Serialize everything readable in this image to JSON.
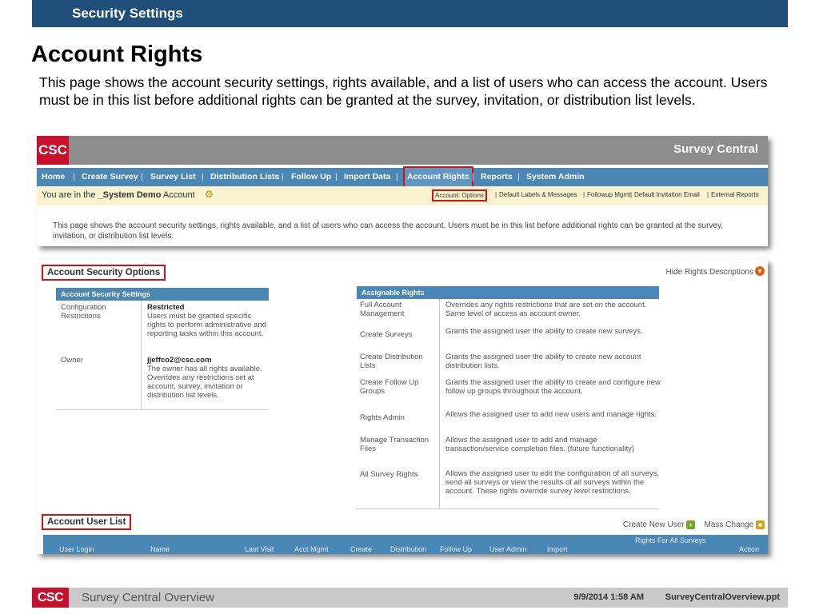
{
  "slide": {
    "header": "Security Settings",
    "title": "Account Rights",
    "description": "This page shows the account security settings, rights available, and a list of users who can access the account. Users must be in this list before additional rights can be granted at the survey, invitation, or distribution list levels."
  },
  "app": {
    "logo": "CSC",
    "title": "Survey Central",
    "nav": [
      "Home",
      "Create Survey",
      "Survey List",
      "Distribution Lists",
      "Follow Up",
      "Import Data",
      "Account Rights",
      "Reports",
      "System Admin"
    ],
    "nav_separator": "|",
    "breadcrumb": {
      "prefix": "You are in the ",
      "account": "_System Demo",
      "suffix": " Account"
    },
    "subnav": [
      "Account: Options",
      "Default Labels & Messages",
      "Followup Mgmt",
      "Default Invitation Email",
      "External Reports"
    ],
    "subnav_separator": "|",
    "page_description": "This page shows the account security settings, rights available, and a list of users who can access the account. Users must be in this list before additional rights can be granted at the survey, invitation, or distribution list levels."
  },
  "options": {
    "section_title": "Account Security Options",
    "hide_rights": "Hide Rights Descriptions",
    "settings_header": "Account Security Settings",
    "settings": [
      {
        "label": "Configuration Restrictions",
        "value": "Restricted",
        "detail": "Users must be granted specific rights to perform administrative and reporting tasks within this account."
      },
      {
        "label": "Owner",
        "value": "jjeffco2@csc.com",
        "detail": "The owner has all rights available. Overrides any restrictions set at account, survey, invitation or distribution list levels."
      }
    ],
    "rights_header": "Assignable Rights",
    "rights": [
      {
        "name": "Full Account Management",
        "desc": "Overrides any rights restrictions that are set on the account. Same level of access as account owner."
      },
      {
        "name": "Create Surveys",
        "desc": "Grants the assigned user the ability to create new surveys."
      },
      {
        "name": "Create Distribution Lists",
        "desc": "Grants the assigned user the ability to create new account distribution lists."
      },
      {
        "name": "Create Follow Up Groups",
        "desc": "Grants the assigned user the ability to create and configure new follow up groups throughout the account."
      },
      {
        "name": "Rights Admin",
        "desc": "Allows the assigned user to add new users and manage rights."
      },
      {
        "name": "Manage Transaction Files",
        "desc": "Allows the assigned user to add and manage transaction/service completion files. (future functionality)"
      },
      {
        "name": "All Survey Rights",
        "desc": "Allows the assigned user to edit the configuration of all surveys, send all surveys or view the results of all surveys within the account. These rights override survey level restrictions."
      }
    ]
  },
  "user_list": {
    "section_title": "Account User List",
    "create_new_user": "Create New User",
    "mass_change": "Mass Change",
    "rights_group_label": "Rights For All Surveys",
    "columns": [
      "User Login",
      "Name",
      "Last Visit",
      "Acct Mgmt",
      "Create",
      "Distribution",
      "Follow Up",
      "User Admin",
      "Import",
      "Action"
    ]
  },
  "footer": {
    "logo": "CSC",
    "title": "Survey Central Overview",
    "date": "9/9/2014 1:58 AM",
    "file": "SurveyCentralOverview.ppt"
  },
  "colors": {
    "slide_header": "#1f4e79",
    "nav_bar": "#4a87b5",
    "brand_red": "#c8102e",
    "highlight_box": "#d31313",
    "crumb_bar": "#f9f4cf"
  }
}
